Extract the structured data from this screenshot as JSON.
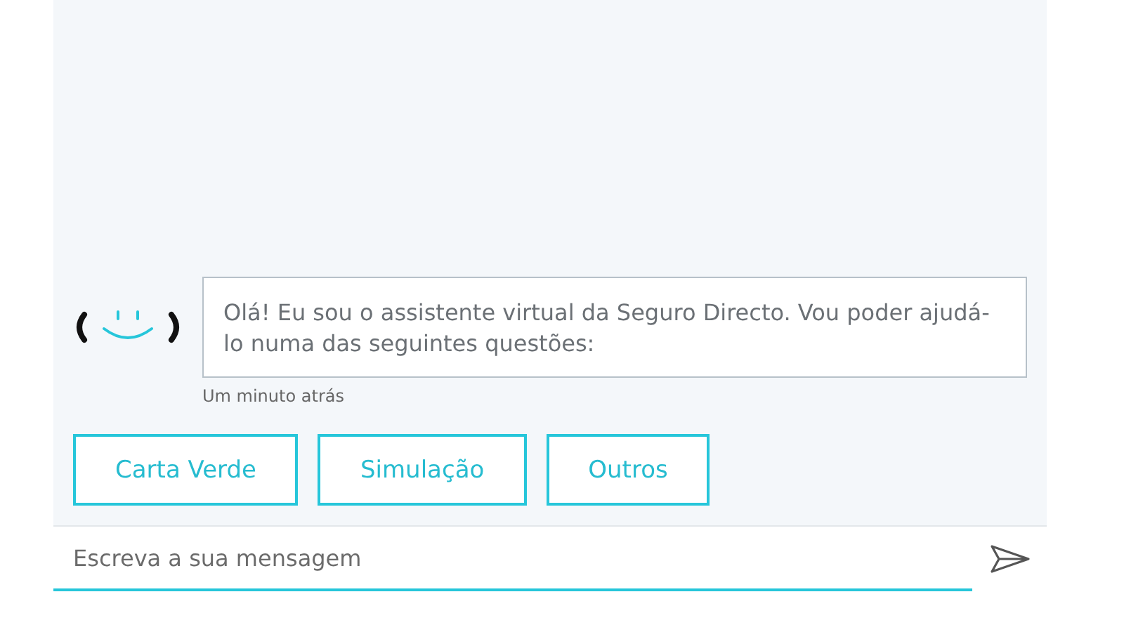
{
  "messages": [
    {
      "text": "Olá! Eu sou o assistente virtual da Seguro Directo. Vou poder ajudá-lo numa das seguintes questões:",
      "time": "Um minuto atrás"
    }
  ],
  "quick_replies": [
    "Carta Verde",
    "Simulação",
    "Outros"
  ],
  "composer": {
    "placeholder": "Escreva a sua mensagem"
  }
}
